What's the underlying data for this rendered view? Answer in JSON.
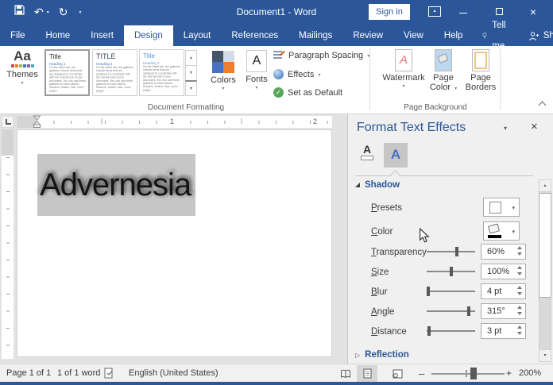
{
  "icons": {
    "close": "×",
    "dropdown": "▾",
    "scroll_up": "▴",
    "scroll_down": "▾",
    "gallery_more": "▾",
    "undo": "↶",
    "redo": "↻",
    "qat_more": "▾",
    "collapsed_triangle": "▷",
    "check": "✓",
    "minus": "–",
    "plus": "+",
    "ribbon_display_arrow": "▴"
  },
  "titlebar": {
    "title": "Document1 - Word",
    "sign_in_label": "Sign in"
  },
  "tabs": {
    "items": [
      "File",
      "Home",
      "Insert",
      "Design",
      "Layout",
      "References",
      "Mailings",
      "Review",
      "View",
      "Help"
    ],
    "active": "Design",
    "tell_me": "Tell me",
    "share": "Share"
  },
  "ribbon": {
    "themes_label": "Themes",
    "themes_icon_text": "Aa",
    "style_gallery": [
      {
        "title": "Title",
        "heading": "Heading 1",
        "selected": true,
        "body": "On the Insert tab, the galleries include items that are designed to coordinate with the overall look of your document. You can use these galleries to insert tables, headers, footers, lists, cover pages."
      },
      {
        "title": "TITLE",
        "heading": "Heading 1",
        "selected": false,
        "body": "On the Insert tab, the galleries include items that are designed to coordinate with the overall look of your document. You can use these galleries to insert tables, headers, footers, lists, cover pages."
      },
      {
        "title": "Title",
        "heading": "Heading 1",
        "selected": false,
        "body": "On the Insert tab, the galleries include items that are designed to coordinate with the overall look of your document. You can use these galleries to insert tables, headers, footers, lists, cover pages."
      }
    ],
    "colors_label": "Colors",
    "fonts_label": "Fonts",
    "fonts_icon_text": "A",
    "paragraph_spacing_label": "Paragraph Spacing",
    "effects_label": "Effects",
    "set_as_default_label": "Set as Default",
    "watermark_label": "Watermark",
    "watermark_icon_letter": "A",
    "page_color_label_1": "Page",
    "page_color_label_2": "Color",
    "page_borders_label_1": "Page",
    "page_borders_label_2": "Borders",
    "groups": {
      "document_formatting": "Document Formatting",
      "page_background": "Page Background"
    }
  },
  "document": {
    "text": "Advernesia",
    "ruler_numbers": [
      "1",
      "2"
    ]
  },
  "panel": {
    "title": "Format Text Effects",
    "tab_a_glyph": "A",
    "shadow_header": "Shadow",
    "reflection_header": "Reflection",
    "presets_label": "Presets",
    "color_label": "Color",
    "sliders": [
      {
        "label": "Transparency",
        "value": "60%",
        "pct": 62
      },
      {
        "label": "Size",
        "value": "100%",
        "pct": 50
      },
      {
        "label": "Blur",
        "value": "4 pt",
        "pct": 4
      },
      {
        "label": "Angle",
        "value": "315°",
        "pct": 87
      },
      {
        "label": "Distance",
        "value": "3 pt",
        "pct": 5
      }
    ]
  },
  "statusbar": {
    "page_indicator": "Page 1 of 1",
    "word_count": "1 of 1 word",
    "language": "English (United States)",
    "zoom_level": "200%"
  },
  "colors": {
    "accent": "#2b579a",
    "selection_highlight": "#c6c6c6",
    "colors_quad": [
      "#44546a",
      "#d6dce5",
      "#4472c4",
      "#ed7d31"
    ],
    "set_default_green": "#57a659",
    "watermark_red": "#e57373"
  }
}
